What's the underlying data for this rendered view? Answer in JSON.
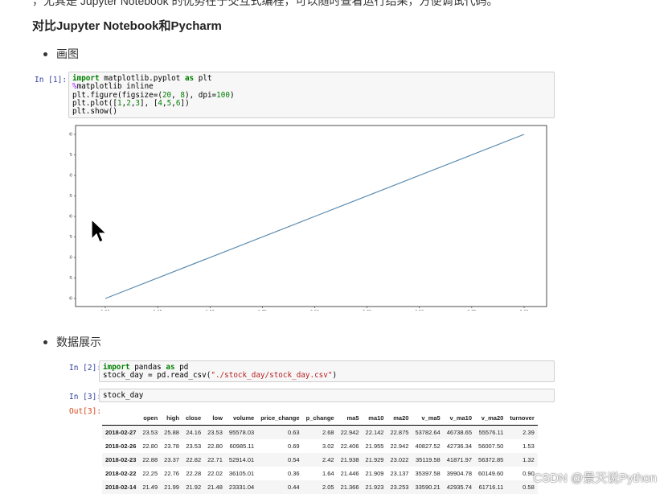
{
  "top_cut_text": "，尤其是 Jupyter Notebook 的优势在于交互式编程，可以随时查看运行结果，方便调试代码。",
  "heading": "对比Jupyter Notebook和Pycharm",
  "bullets": [
    "画图",
    "数据展示"
  ],
  "cells": [
    {
      "prompt": "In [1]:"
    },
    {
      "prompt": "In [2]:"
    },
    {
      "prompt": "In [3]:",
      "code": "stock_day"
    }
  ],
  "out_prompt": "Out[3]:",
  "chart_data": {
    "type": "line",
    "x": [
      1,
      2,
      3
    ],
    "y": [
      4,
      5,
      6
    ],
    "xlim": [
      1,
      3
    ],
    "ylim": [
      4,
      6
    ],
    "xticks": [
      "1.00",
      "1.25",
      "1.50",
      "1.75",
      "2.00",
      "2.25",
      "2.50",
      "2.75",
      "3.00"
    ],
    "yticks": [
      "4.00",
      "4.25",
      "4.50",
      "4.75",
      "5.00",
      "5.25",
      "5.50",
      "5.75",
      "6.00"
    ],
    "line_color": "#5a8bb0",
    "grid": false
  },
  "table": {
    "columns": [
      "open",
      "high",
      "close",
      "low",
      "volume",
      "price_change",
      "p_change",
      "ma5",
      "ma10",
      "ma20",
      "v_ma5",
      "v_ma10",
      "v_ma20",
      "turnover"
    ],
    "rows": [
      {
        "index": "2018-02-27",
        "values": [
          "23.53",
          "25.88",
          "24.16",
          "23.53",
          "95578.03",
          "0.63",
          "2.68",
          "22.942",
          "22.142",
          "22.875",
          "53782.64",
          "46738.65",
          "55576.11",
          "2.39"
        ]
      },
      {
        "index": "2018-02-26",
        "values": [
          "22.80",
          "23.78",
          "23.53",
          "22.80",
          "60985.11",
          "0.69",
          "3.02",
          "22.406",
          "21.955",
          "22.942",
          "40827.52",
          "42736.34",
          "56007.50",
          "1.53"
        ]
      },
      {
        "index": "2018-02-23",
        "values": [
          "22.88",
          "23.37",
          "22.82",
          "22.71",
          "52914.01",
          "0.54",
          "2.42",
          "21.938",
          "21.929",
          "23.022",
          "35119.58",
          "41871.97",
          "56372.85",
          "1.32"
        ]
      },
      {
        "index": "2018-02-22",
        "values": [
          "22.25",
          "22.76",
          "22.28",
          "22.02",
          "36105.01",
          "0.36",
          "1.64",
          "21.446",
          "21.909",
          "23.137",
          "35397.58",
          "39904.78",
          "60149.60",
          "0.90"
        ]
      },
      {
        "index": "2018-02-14",
        "values": [
          "21.49",
          "21.99",
          "21.92",
          "21.48",
          "23331.04",
          "0.44",
          "2.05",
          "21.366",
          "21.923",
          "23.253",
          "33590.21",
          "42935.74",
          "61716.11",
          "0.58"
        ]
      }
    ]
  },
  "watermark": "CSDN @景天说Python"
}
